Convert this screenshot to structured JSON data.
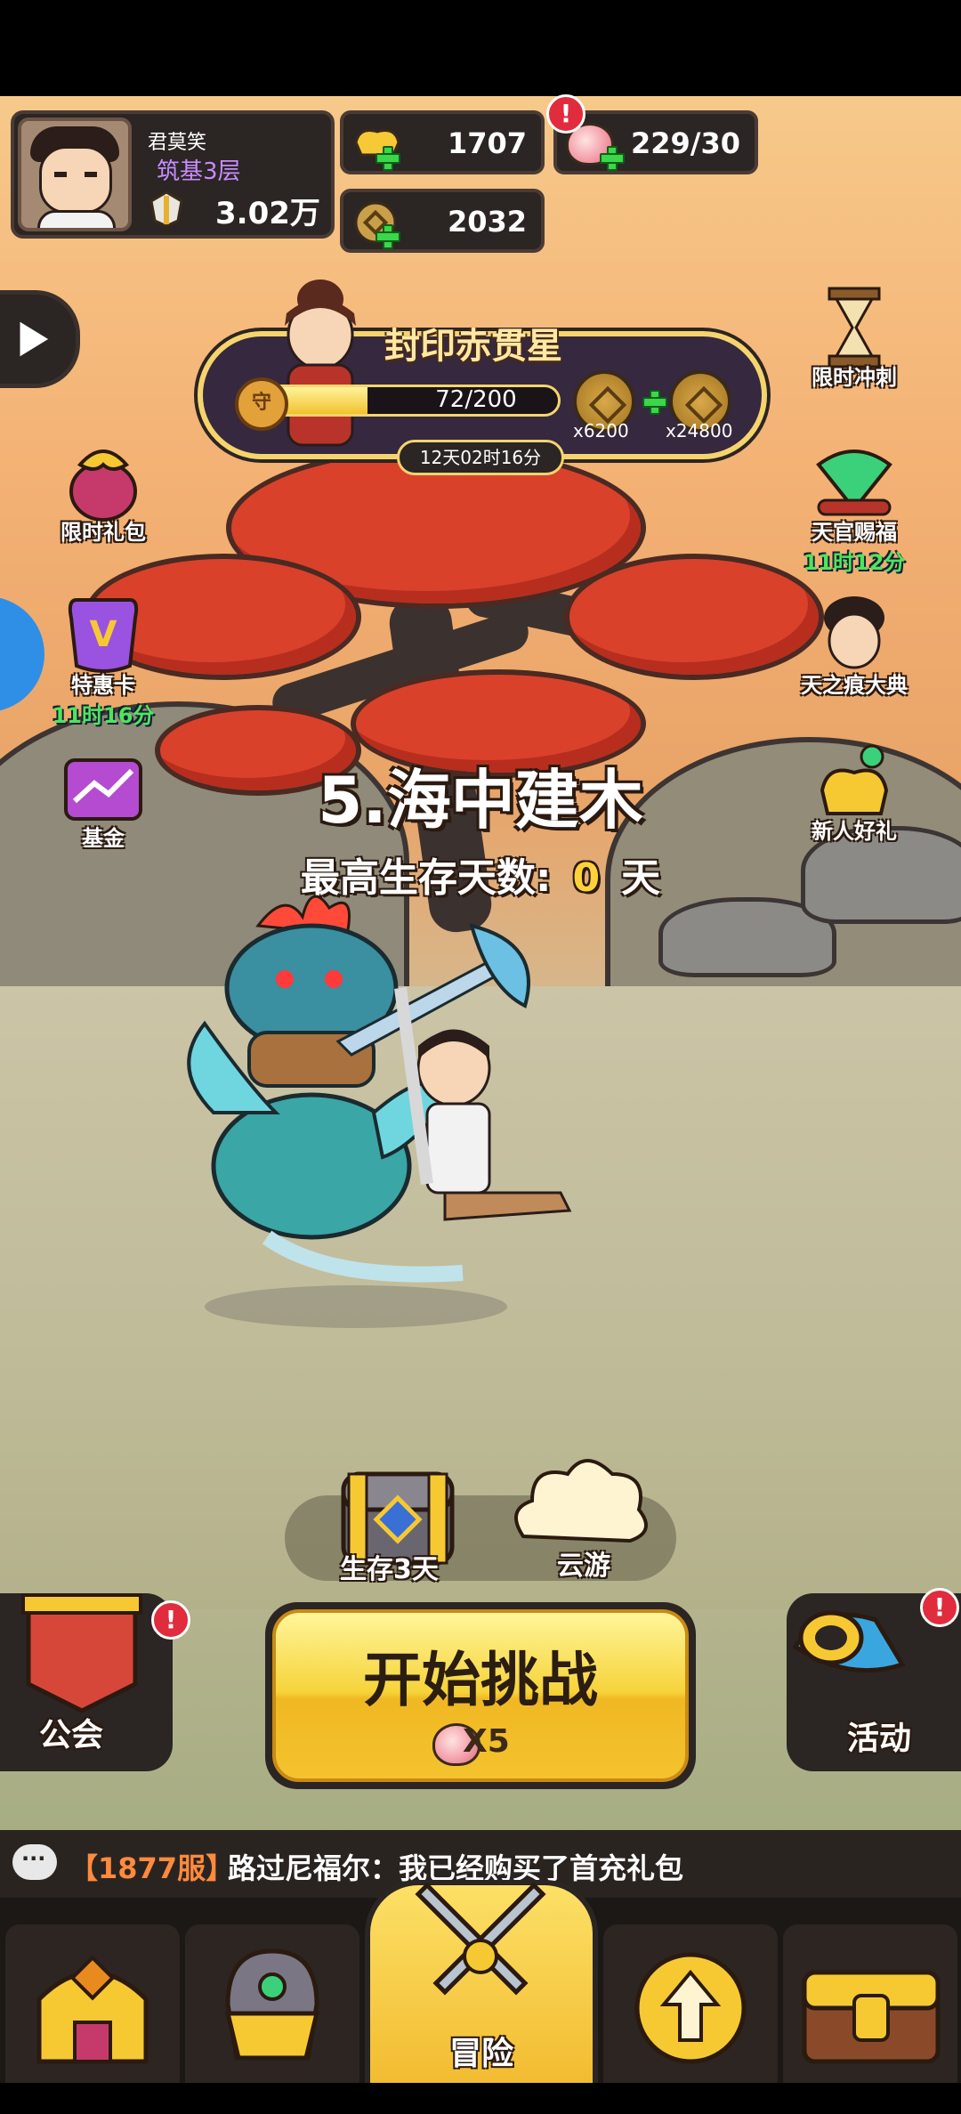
{
  "player": {
    "name": "君莫笑",
    "rank": "筑基3层",
    "power": "3.02万"
  },
  "resources": {
    "gold": "1707",
    "peach": "229/30",
    "coins": "2032",
    "peach_alert": "!"
  },
  "event": {
    "title": "封印赤贯星",
    "progress_text": "72/200",
    "progress_fraction": 0.36,
    "shield_char": "守",
    "reward1": "x6200",
    "reward2": "x24800",
    "timer": "12天02时16分"
  },
  "left_icons": [
    {
      "label": "限时礼包"
    },
    {
      "label": "特惠卡",
      "timer": "11时16分"
    },
    {
      "label": "基金"
    }
  ],
  "right_icons": [
    {
      "label": "限时冲刺"
    },
    {
      "label": "天官赐福",
      "timer": "11时12分"
    },
    {
      "label": "天之痕大典"
    },
    {
      "label": "新人好礼"
    }
  ],
  "stage": {
    "title": "5.海中建木",
    "survival_label": "最高生存天数:",
    "survival_days": "0",
    "survival_unit": "天"
  },
  "rewards": {
    "chest_label": "生存3天",
    "cloud_label": "云游"
  },
  "actions": {
    "guild_label": "公会",
    "start_label": "开始挑战",
    "start_cost": "X5",
    "activity_label": "活动",
    "alert": "!"
  },
  "chat": {
    "server": "【1877服】",
    "message": "路过尼福尔：我已经购买了首充礼包"
  },
  "nav": {
    "active_label": "冒险"
  },
  "colors": {
    "accent_gold": "#f6d33a",
    "timer_green": "#52e35d",
    "alert_red": "#e02c3d",
    "rank_purple": "#c88cff"
  }
}
